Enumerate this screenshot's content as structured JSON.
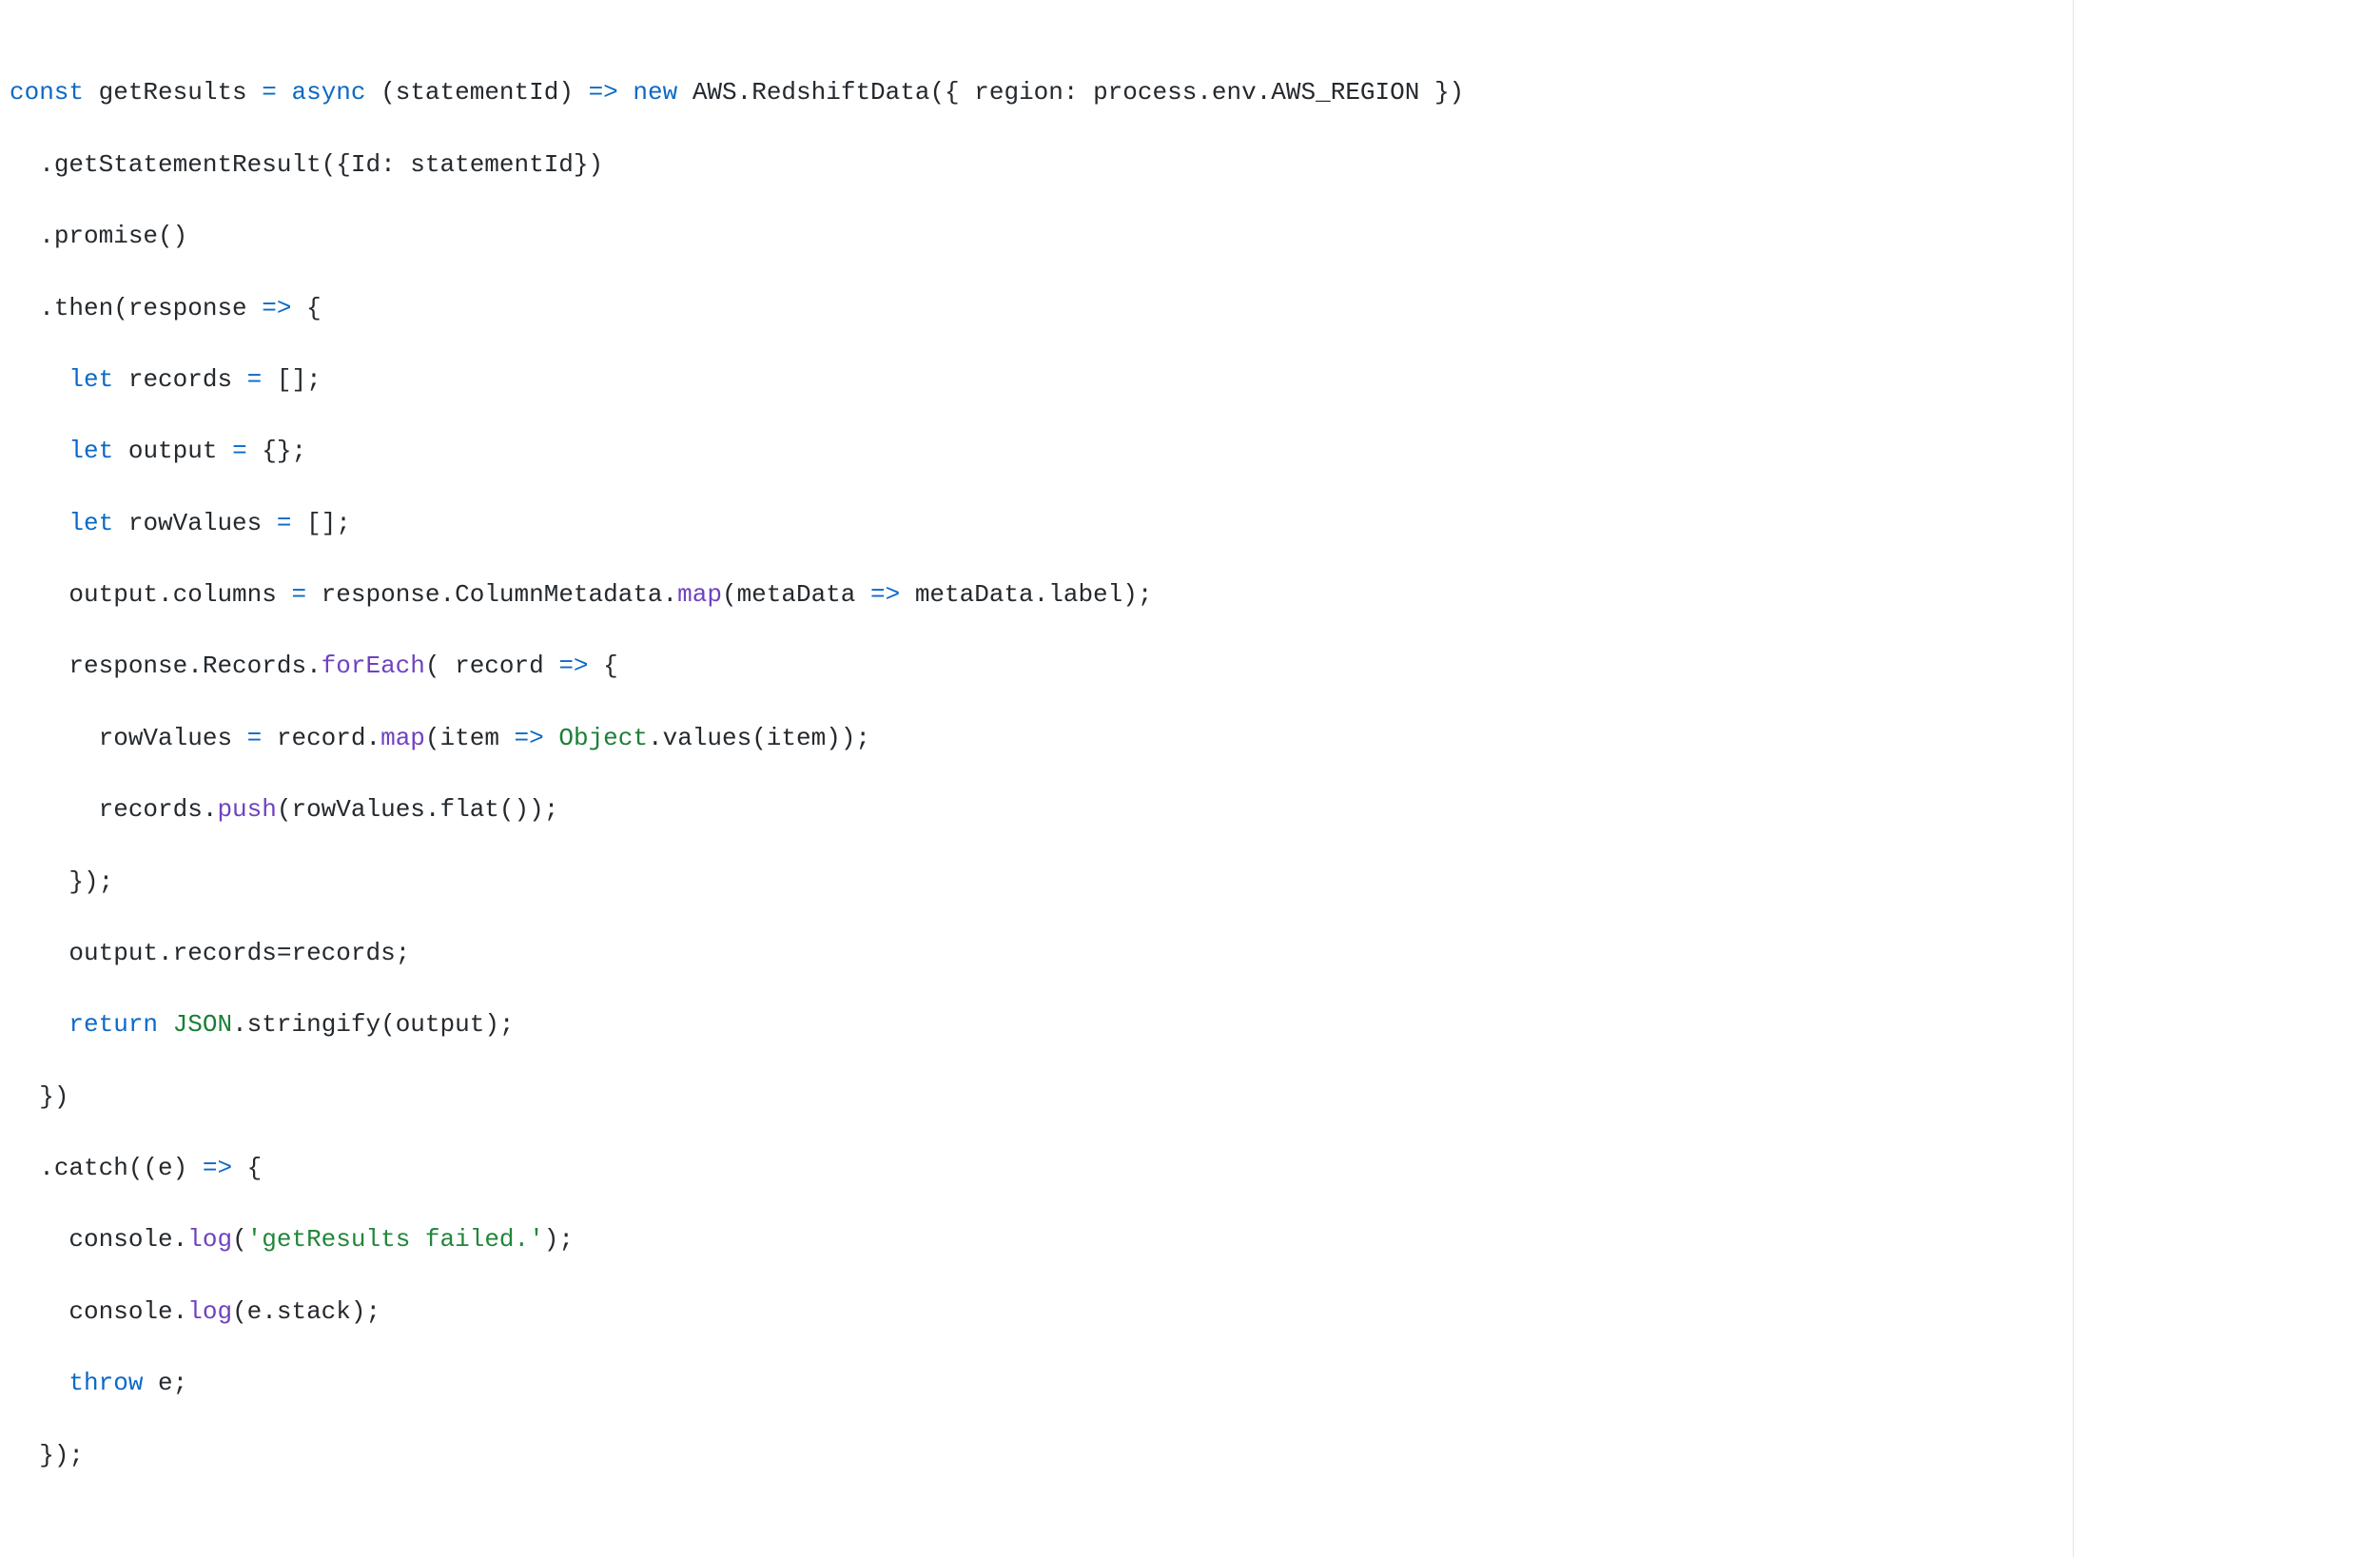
{
  "syntax": {
    "kw_const": "const",
    "kw_async": "async",
    "kw_new": "new",
    "kw_let": "let",
    "kw_return": "return",
    "kw_throw": "throw",
    "arrow": "=>",
    "eq": "="
  },
  "code": {
    "fn_name": "getResults",
    "param1": "(statementId)",
    "ctor": "AWS.RedshiftData({ region: process.env.AWS_REGION })",
    "m_getStatementResult": ".getStatementResult({Id: statementId})",
    "m_promise": ".promise()",
    "then_open": ".then(response ",
    "brace_open": " {",
    "let_records": " records ",
    "let_records_rhs": " [];",
    "let_output": " output ",
    "let_output_rhs": " {};",
    "let_rowValues": " rowValues ",
    "let_rowValues_rhs": " [];",
    "columns_lhs": "output.columns ",
    "columns_rhs_a": " response.ColumnMetadata.",
    "map": "map",
    "columns_rhs_b": "(metaData ",
    "columns_rhs_c": " metaData.label);",
    "foreach_a": "response.Records.",
    "forEach": "forEach",
    "foreach_b": "( record ",
    "foreach_c": " {",
    "rowvals_a": "rowValues ",
    "rowvals_b": " record.",
    "rowvals_c": "(item ",
    "object": "Object",
    "rowvals_d": ".values(item));",
    "push_a": "records.",
    "push": "push",
    "push_b": "(rowValues.flat());",
    "foreach_close": "});",
    "assign_records": "output.records=records;",
    "json": "JSON",
    "stringify": ".stringify(output);",
    "then_close": "})",
    "catch_open_a": ".catch((e) ",
    "catch_open_b": " {",
    "log": "log",
    "log1_a": "console.",
    "log1_str": "'getResults failed.'",
    "log1_b": ");",
    "log2_a": "console.",
    "log2_b": "(e.stack);",
    "throw_rest": " e;",
    "catch_close": "});"
  },
  "indent": {
    "i1": "  ",
    "i2": "    ",
    "i3": "      "
  }
}
